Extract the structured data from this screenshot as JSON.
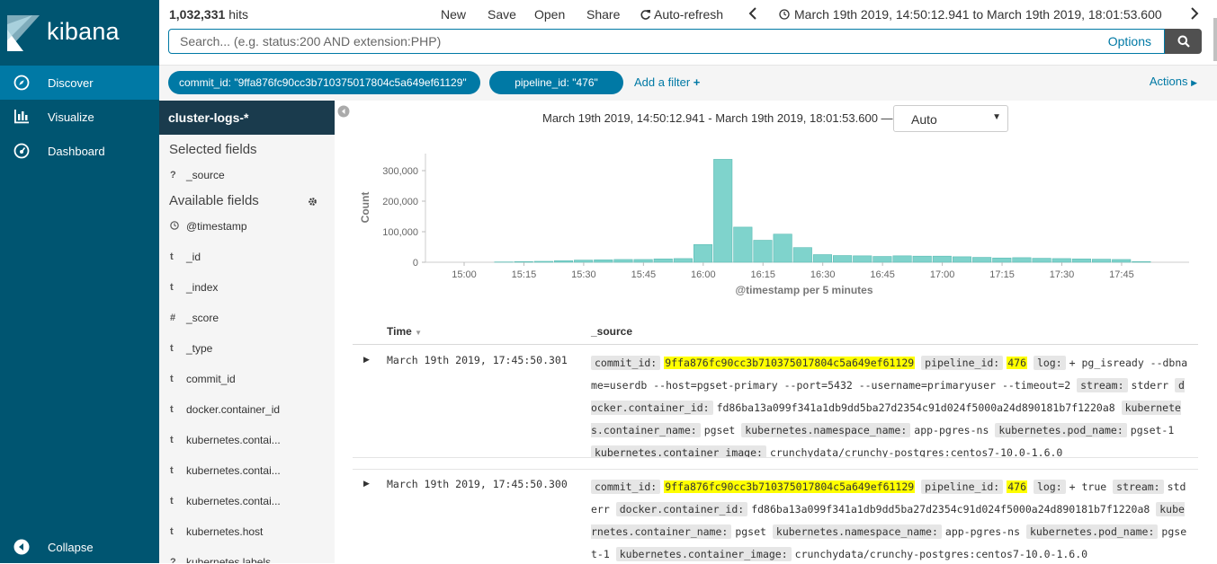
{
  "app": {
    "brand": "kibana",
    "nav": [
      {
        "label": "Discover",
        "icon": "compass-icon",
        "active": true
      },
      {
        "label": "Visualize",
        "icon": "bar-chart-icon",
        "active": false
      },
      {
        "label": "Dashboard",
        "icon": "dashboard-gauge-icon",
        "active": false
      }
    ],
    "collapse_label": "Collapse"
  },
  "top": {
    "hits_count": "1,032,331",
    "hits_label": "hits",
    "menu": [
      "New",
      "Save",
      "Open",
      "Share"
    ],
    "auto_refresh": "Auto-refresh",
    "time_range": "March 19th 2019, 14:50:12.941 to March 19th 2019, 18:01:53.600"
  },
  "search": {
    "placeholder": "Search... (e.g. status:200 AND extension:PHP)",
    "value": "",
    "options_label": "Options"
  },
  "filters": {
    "pills": [
      {
        "label": "commit_id: \"9ffa876fc90cc3b710375017804c5a649ef61129\""
      },
      {
        "label": "pipeline_id: \"476\""
      }
    ],
    "add_filter": "Add a filter",
    "actions": "Actions"
  },
  "sidebar": {
    "index_pattern": "cluster-logs-*",
    "selected_title": "Selected fields",
    "selected": [
      {
        "type": "?",
        "name": "_source"
      }
    ],
    "available_title": "Available fields",
    "available": [
      {
        "type": "clock",
        "name": "@timestamp"
      },
      {
        "type": "t",
        "name": "_id"
      },
      {
        "type": "t",
        "name": "_index"
      },
      {
        "type": "#",
        "name": "_score"
      },
      {
        "type": "t",
        "name": "_type"
      },
      {
        "type": "t",
        "name": "commit_id"
      },
      {
        "type": "t",
        "name": "docker.container_id"
      },
      {
        "type": "t",
        "name": "kubernetes.contai..."
      },
      {
        "type": "t",
        "name": "kubernetes.contai..."
      },
      {
        "type": "t",
        "name": "kubernetes.contai..."
      },
      {
        "type": "t",
        "name": "kubernetes.host"
      },
      {
        "type": "?",
        "name": "kubernetes.labels..."
      }
    ]
  },
  "histogram": {
    "range_text": "March 19th 2019, 14:50:12.941 - March 19th 2019, 18:01:53.600 —",
    "interval": "Auto"
  },
  "chart_data": {
    "type": "bar",
    "xlabel": "@timestamp per 5 minutes",
    "ylabel": "Count",
    "ylim": [
      0,
      350000
    ],
    "yticks": [
      "0",
      "100,000",
      "200,000",
      "300,000"
    ],
    "ytick_values": [
      0,
      100000,
      200000,
      300000
    ],
    "xticks": [
      "15:00",
      "15:15",
      "15:30",
      "15:45",
      "16:00",
      "16:15",
      "16:30",
      "16:45",
      "17:00",
      "17:15",
      "17:30",
      "17:45"
    ],
    "categories": [
      "15:10",
      "15:15",
      "15:20",
      "15:25",
      "15:30",
      "15:35",
      "15:40",
      "15:45",
      "15:50",
      "15:55",
      "16:00",
      "16:05",
      "16:10",
      "16:15",
      "16:20",
      "16:25",
      "16:30",
      "16:35",
      "16:40",
      "16:45",
      "16:50",
      "16:55",
      "17:00",
      "17:05",
      "17:10",
      "17:15",
      "17:20",
      "17:25",
      "17:30",
      "17:35",
      "17:40",
      "17:45",
      "17:50"
    ],
    "values": [
      1000,
      2000,
      3000,
      5000,
      7000,
      8000,
      9000,
      9000,
      11000,
      12000,
      58000,
      337000,
      115000,
      72000,
      92000,
      48000,
      25000,
      22000,
      21000,
      19000,
      21000,
      20000,
      20000,
      18000,
      16000,
      14000,
      15000,
      13000,
      12000,
      11000,
      10000,
      9000,
      2000
    ],
    "grid": false,
    "color": "#7fd3cc"
  },
  "table": {
    "col_time": "Time",
    "col_source": "_source",
    "rows": [
      {
        "time": "March 19th 2019, 17:45:50.301",
        "fields": [
          {
            "k": "commit_id:",
            "v": "9ffa876fc90cc3b710375017804c5a649ef61129",
            "hl": true
          },
          {
            "k": "pipeline_id:",
            "v": "476",
            "hl": true
          },
          {
            "k": "log:",
            "v": "+ pg_isready --dbname=userdb --host=pgset-primary --port=5432 --username=primaryuser --timeout=2",
            "hl": false
          },
          {
            "k": "stream:",
            "v": "stderr",
            "hl": false
          },
          {
            "k": "docker.container_id:",
            "v": "fd86ba13a099f341a1db9dd5ba27d2354c91d024f5000a24d890181b7f1220a8",
            "hl": false
          },
          {
            "k": "kubernetes.container_name:",
            "v": "pgset",
            "hl": false
          },
          {
            "k": "kubernetes.namespace_name:",
            "v": "app-pgres-ns",
            "hl": false
          },
          {
            "k": "kubernetes.pod_name:",
            "v": "pgset-1",
            "hl": false
          },
          {
            "k": "kubernetes.container_image:",
            "v": "crunchydata/crunchy-postgres:centos7-10.0-1.6.0",
            "hl": false
          }
        ]
      },
      {
        "time": "March 19th 2019, 17:45:50.300",
        "fields": [
          {
            "k": "commit_id:",
            "v": "9ffa876fc90cc3b710375017804c5a649ef61129",
            "hl": true
          },
          {
            "k": "pipeline_id:",
            "v": "476",
            "hl": true
          },
          {
            "k": "log:",
            "v": "+ true",
            "hl": false
          },
          {
            "k": "stream:",
            "v": "stderr",
            "hl": false
          },
          {
            "k": "docker.container_id:",
            "v": "fd86ba13a099f341a1db9dd5ba27d2354c91d024f5000a24d890181b7f1220a8",
            "hl": false
          },
          {
            "k": "kubernetes.container_name:",
            "v": "pgset",
            "hl": false
          },
          {
            "k": "kubernetes.namespace_name:",
            "v": "app-pgres-ns",
            "hl": false
          },
          {
            "k": "kubernetes.pod_name:",
            "v": "pgset-1",
            "hl": false
          },
          {
            "k": "kubernetes.container_image:",
            "v": "crunchydata/crunchy-postgres:centos7-10.0-1.6.0",
            "hl": false
          }
        ]
      }
    ]
  },
  "colors": {
    "nav_bg": "#005571",
    "nav_active": "#0079a5",
    "accent": "#0079a5",
    "bar": "#7fd3cc",
    "highlight": "#ffff00"
  }
}
